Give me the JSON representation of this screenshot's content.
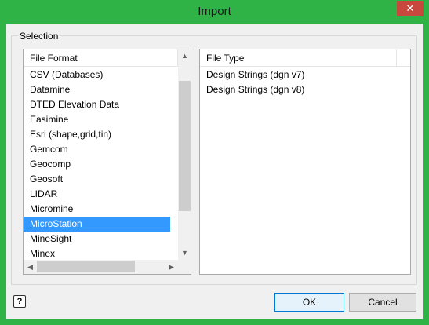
{
  "window": {
    "title": "Import",
    "close_glyph": "✕"
  },
  "groupbox": {
    "label": "Selection"
  },
  "left_list": {
    "header": "File Format",
    "items": [
      "CSV (Databases)",
      "Datamine",
      "DTED Elevation Data",
      "Easimine",
      "Esri (shape,grid,tin)",
      "Gemcom",
      "Geocomp",
      "Geosoft",
      "LIDAR",
      "Micromine",
      "MicroStation",
      "MineSight",
      "Minex"
    ],
    "selected": "MicroStation",
    "scroll_up": "▲",
    "scroll_down": "▼",
    "scroll_left": "◀",
    "scroll_right": "▶"
  },
  "right_list": {
    "header": "File Type",
    "items": [
      "Design Strings (dgn v7)",
      "Design Strings (dgn v8)"
    ]
  },
  "footer": {
    "help_icon": "?",
    "ok_label": "OK",
    "cancel_label": "Cancel"
  },
  "colors": {
    "frame": "#2fb246",
    "close": "#c9483e",
    "selection": "#3399ff"
  }
}
